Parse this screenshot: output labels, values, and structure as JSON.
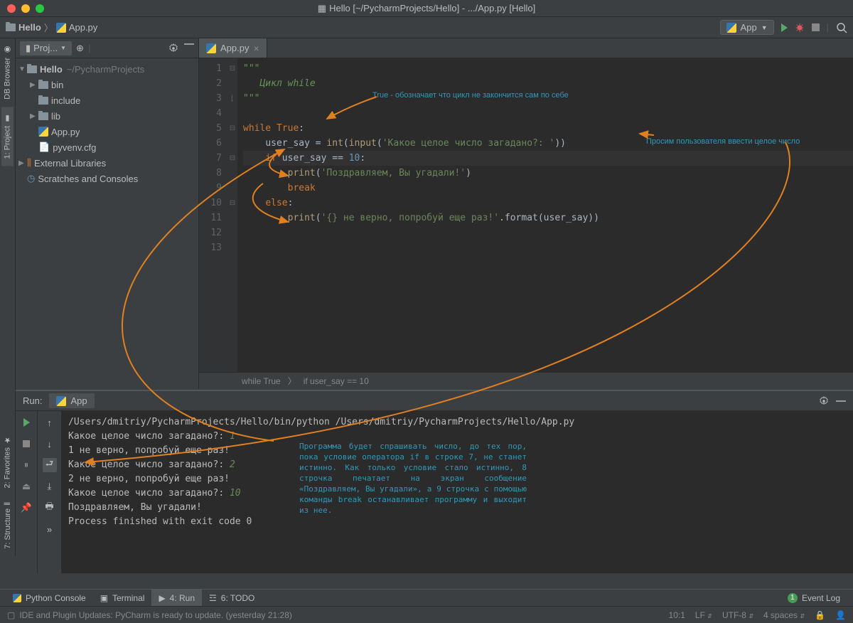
{
  "window": {
    "title": "Hello [~/PycharmProjects/Hello] - .../App.py [Hello]"
  },
  "breadcrumb": {
    "project": "Hello",
    "file": "App.py"
  },
  "run_config": {
    "name": "App"
  },
  "left_gutter": {
    "db_browser": "DB Browser",
    "project": "1: Project",
    "favorites": "2: Favorites",
    "structure": "7: Structure"
  },
  "project_panel": {
    "title": "Proj...",
    "tree": {
      "root": "Hello",
      "root_path": "~/PycharmProjects",
      "bin": "bin",
      "include": "include",
      "lib": "lib",
      "app": "App.py",
      "pyvenv": "pyvenv.cfg",
      "ext": "External Libraries",
      "scratch": "Scratches and Consoles"
    }
  },
  "editor": {
    "tab": "App.py",
    "lines": {
      "l1": "\"\"\"",
      "l2_prefix": "   ",
      "l2": "Цикл while",
      "l3": "\"\"\"",
      "l5_kw": "while ",
      "l5_true": "True",
      "l5_colon": ":",
      "l6_ind": "    ",
      "l6_var": "user_say ",
      "l6_eq": "= ",
      "l6_int": "int",
      "l6_op": "(",
      "l6_input": "input",
      "l6_op2": "(",
      "l6_str": "'Какое целое число загадано?: '",
      "l6_cp": "))",
      "l7_ind": "    ",
      "l7_if": "if ",
      "l7_cond": "user_say == ",
      "l7_num": "10",
      "l7_colon": ":",
      "l8_ind": "        ",
      "l8_print": "print",
      "l8_op": "(",
      "l8_str": "'Поздравляем, Вы угадали!'",
      "l8_cp": ")",
      "l9_ind": "        ",
      "l9_break": "break",
      "l10_ind": "    ",
      "l10_else": "else",
      "l10_colon": ":",
      "l11_ind": "        ",
      "l11_print": "print",
      "l11_op": "(",
      "l11_str": "'{} не верно, попробуй еще раз!'",
      "l11_dot": ".",
      "l11_format": "format",
      "l11_arg": "(user_say))"
    },
    "line_numbers": [
      "1",
      "2",
      "3",
      "4",
      "5",
      "6",
      "7",
      "8",
      "9",
      "10",
      "11",
      "12",
      "13"
    ],
    "crumbs": {
      "a": "while True",
      "b": "if user_say == 10"
    }
  },
  "annotations": {
    "a1": "True - обозначает что цикл не закончится сам по себе",
    "a2": "Просим пользователя ввести целое число",
    "a3": "Программа будет спрашивать число, до тех пор, пока условие оператора if в строке 7, не станет истинно. Как только условие стало истинно, 8 строчка печатает на экран сообщение «Поздравляем, Вы угадали», а 9 строчка с помощью команды break останавливает программу и выходит из нее."
  },
  "run": {
    "title": "Run:",
    "tab": "App",
    "lines": [
      "/Users/dmitriy/PycharmProjects/Hello/bin/python /Users/dmitriy/PycharmProjects/Hello/App.py",
      {
        "p": "Какое целое число загадано?: ",
        "u": "1"
      },
      "1 не верно, попробуй еще раз!",
      {
        "p": "Какое целое число загадано?: ",
        "u": "2"
      },
      "2 не верно, попробуй еще раз!",
      {
        "p": "Какое целое число загадано?: ",
        "u": "10"
      },
      "Поздравляем, Вы угадали!",
      "",
      "Process finished with exit code 0"
    ]
  },
  "bottom_tabs": {
    "console": "Python Console",
    "terminal": "Terminal",
    "run": "4: Run",
    "todo": "6: TODO",
    "event_log": "Event Log",
    "event_badge": "1"
  },
  "status": {
    "msg": "IDE and Plugin Updates: PyCharm is ready to update. (yesterday 21:28)",
    "pos": "10:1",
    "lf": "LF",
    "enc": "UTF-8",
    "indent": "4 spaces"
  }
}
